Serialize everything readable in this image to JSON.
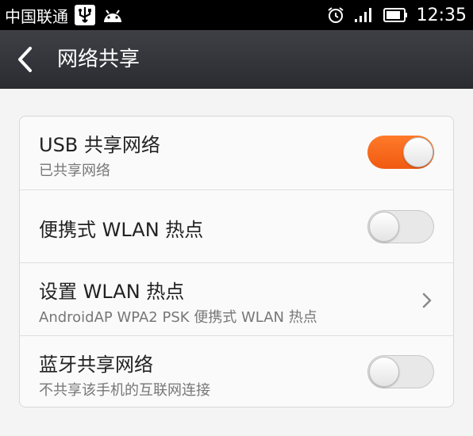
{
  "status_bar": {
    "carrier": "中国联通",
    "time": "12:35",
    "icons": [
      "usb-icon",
      "android-icon",
      "alarm-icon",
      "signal-icon",
      "battery-icon"
    ]
  },
  "header": {
    "title": "网络共享"
  },
  "settings": {
    "items": [
      {
        "title": "USB 共享网络",
        "subtitle": "已共享网络",
        "control": "toggle",
        "on": true
      },
      {
        "title": "便携式 WLAN 热点",
        "control": "toggle",
        "on": false
      },
      {
        "title": "设置 WLAN 热点",
        "subtitle": "AndroidAP WPA2 PSK 便携式 WLAN 热点",
        "control": "chevron"
      },
      {
        "title": "蓝牙共享网络",
        "subtitle": "不共享该手机的互联网连接",
        "control": "toggle",
        "on": false
      }
    ]
  },
  "colors": {
    "accent": "#f26a1b",
    "title_bar": "#33353a",
    "background": "#f4f4f4"
  }
}
